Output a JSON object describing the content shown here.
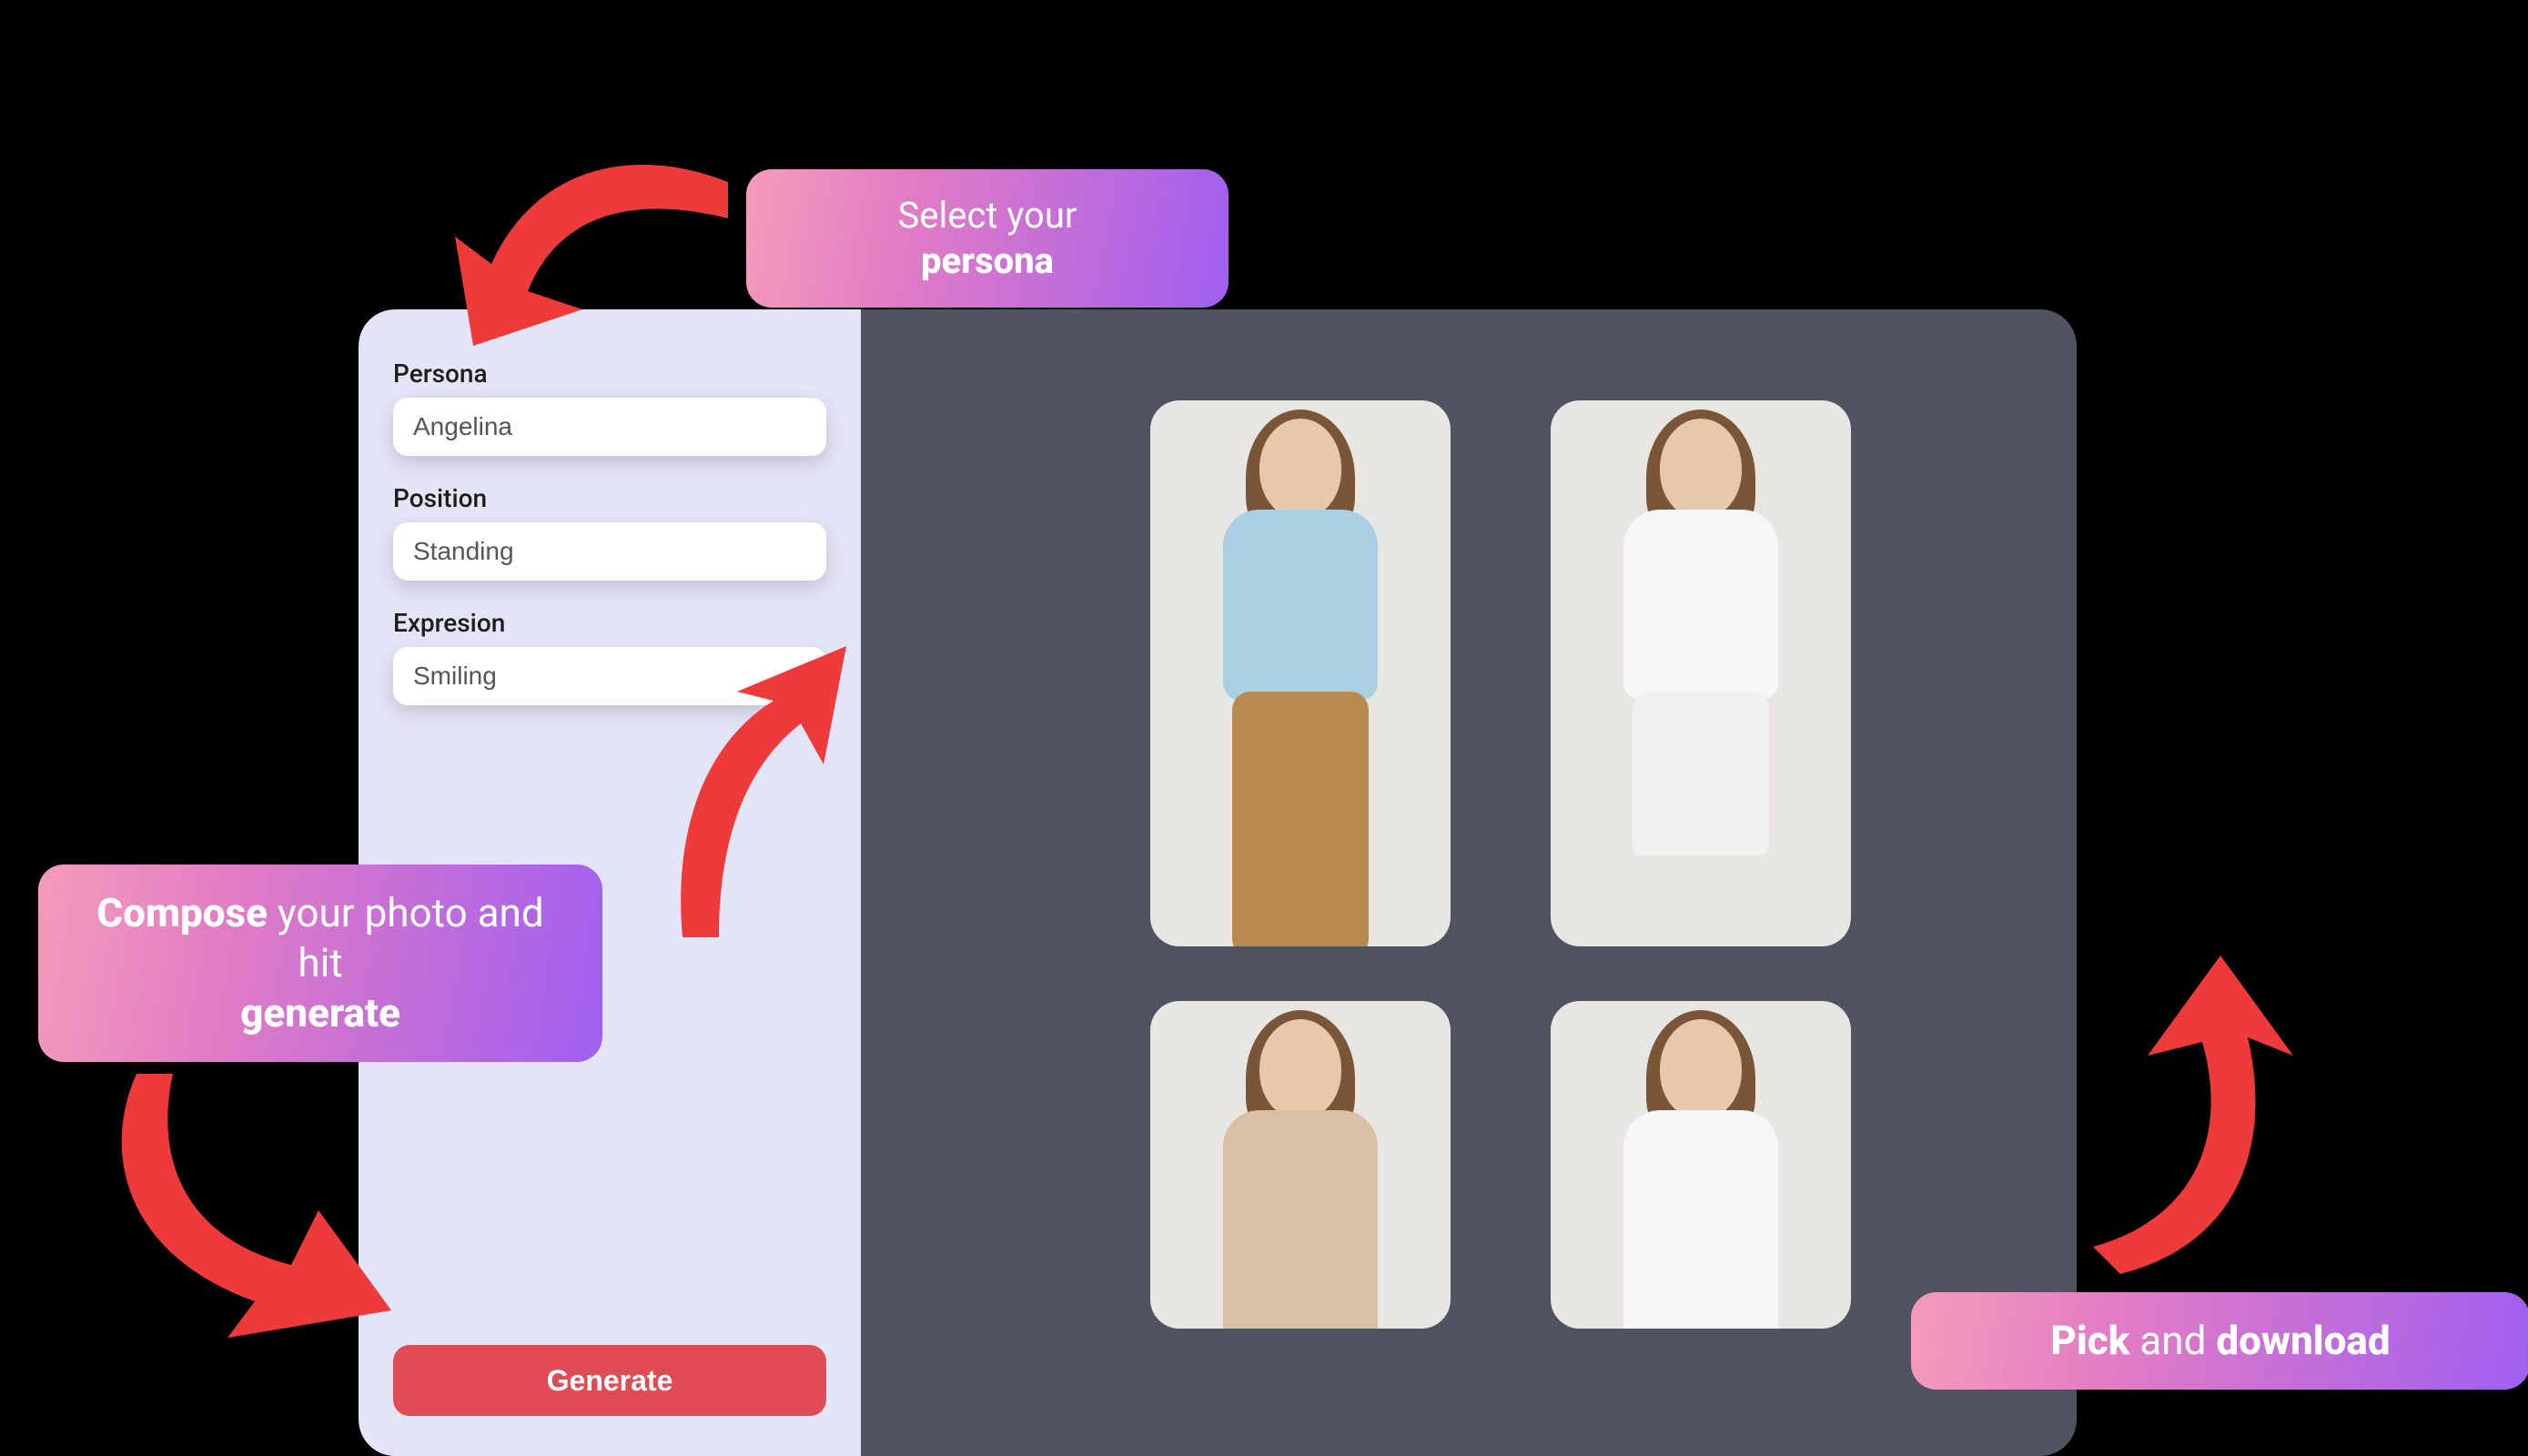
{
  "sidebar": {
    "fields": [
      {
        "label": "Persona",
        "value": "Angelina"
      },
      {
        "label": "Position",
        "value": "Standing"
      },
      {
        "label": "Expresion",
        "value": "Smiling"
      }
    ],
    "generate_label": "Generate"
  },
  "callouts": {
    "persona": {
      "pre": "Select your ",
      "bold": "persona"
    },
    "compose": {
      "bold1": "Compose",
      "mid": " your photo and hit ",
      "bold2": "generate"
    },
    "pick": {
      "bold1": "Pick",
      "mid": " and ",
      "bold2": "download"
    }
  }
}
